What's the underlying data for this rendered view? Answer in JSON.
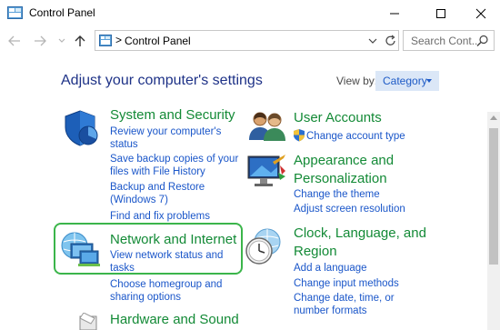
{
  "window": {
    "title": "Control Panel"
  },
  "address_bar": {
    "path_separator": ">",
    "path": "Control Panel"
  },
  "search": {
    "placeholder": "Search Cont..."
  },
  "header": {
    "heading": "Adjust your computer's settings",
    "view_by_label": "View by:",
    "view_by_value": "Category"
  },
  "categories": {
    "system_security": {
      "title": "System and Security",
      "links": [
        "Review your computer's",
        "status",
        "Save backup copies of your",
        "files with File History",
        "Backup and Restore",
        "(Windows 7)",
        "Find and fix problems"
      ]
    },
    "network_internet": {
      "title": "Network and Internet",
      "links": [
        "View network status and",
        "tasks",
        "Choose homegroup and",
        "sharing options"
      ]
    },
    "hardware_sound": {
      "title": "Hardware and Sound"
    },
    "user_accounts": {
      "title": "User Accounts",
      "links": [
        "Change account type"
      ]
    },
    "appearance": {
      "title_line1": "Appearance and",
      "title_line2": "Personalization",
      "links": [
        "Change the theme",
        "Adjust screen resolution"
      ]
    },
    "clock": {
      "title_line1": "Clock, Language, and",
      "title_line2": "Region",
      "links": [
        "Add a language",
        "Change input methods",
        "Change date, time, or",
        "number formats"
      ]
    }
  },
  "colors": {
    "heading": "#1e3287",
    "category_title": "#138a36",
    "link": "#1a56c9",
    "highlight": "#3bb54a"
  }
}
